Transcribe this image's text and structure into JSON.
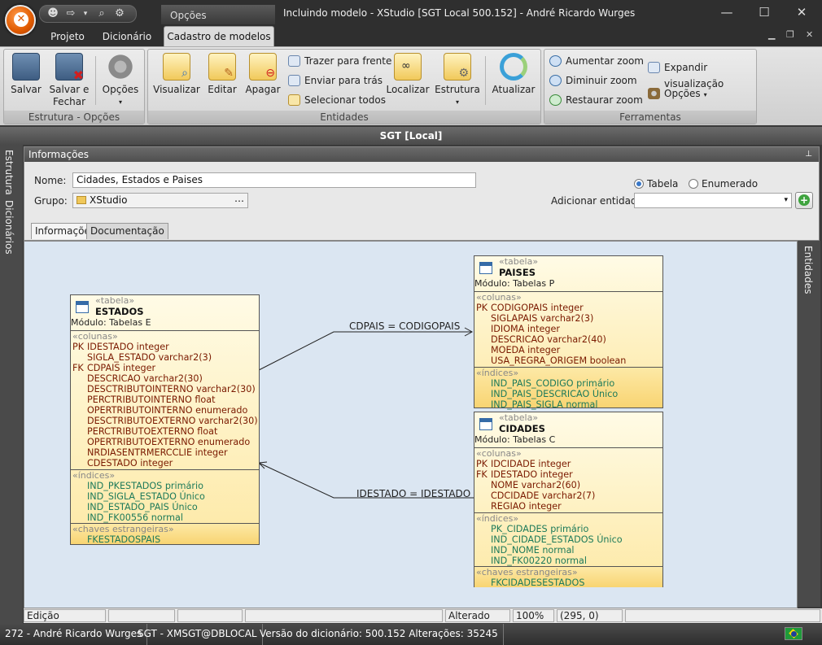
{
  "window": {
    "title": "Incluindo modelo - XStudio [SGT Local 500.152] - André Ricardo Wurges",
    "contextual_tab_group": "Opções"
  },
  "ribbon_tabs": [
    "Projeto",
    "Dicionário",
    "Cadastro de modelos"
  ],
  "ribbon": {
    "groups": {
      "estrutura_opcoes": {
        "caption": "Estrutura - Opções",
        "salvar": "Salvar",
        "salvar_fechar_1": "Salvar e",
        "salvar_fechar_2": "Fechar",
        "opcoes": "Opções"
      },
      "entidades": {
        "caption": "Entidades",
        "visualizar": "Visualizar",
        "editar": "Editar",
        "apagar": "Apagar",
        "trazer": "Trazer para frente",
        "enviar": "Enviar para trás",
        "selecionar": "Selecionar todos",
        "localizar": "Localizar",
        "estrutura": "Estrutura",
        "atualizar": "Atualizar"
      },
      "ferramentas": {
        "caption": "Ferramentas",
        "aumentar": "Aumentar zoom",
        "diminuir": "Diminuir zoom",
        "restaurar": "Restaurar zoom",
        "expandir": "Expandir visualização",
        "opcoes": "Opções"
      }
    }
  },
  "connection_bar": "SGT [Local]",
  "left_tabs": [
    "Estrutura",
    "Dicionários"
  ],
  "right_tabs": [
    "Entidades"
  ],
  "info_panel": {
    "header": "Informações",
    "nome_label": "Nome:",
    "nome_value": "Cidades, Estados e Paises",
    "grupo_label": "Grupo:",
    "grupo_value": "XStudio",
    "radio_tabela": "Tabela",
    "radio_enumerado": "Enumerado",
    "adicionar_label": "Adicionar entidade:",
    "tabs": [
      "Informações",
      "Documentação"
    ]
  },
  "diagram": {
    "estados": {
      "stereotype": "«tabela»",
      "name": "ESTADOS",
      "module": "Módulo: Tabelas E",
      "colunas_label": "«colunas»",
      "columns": [
        {
          "key": "PK",
          "text": "IDESTADO integer"
        },
        {
          "key": "",
          "text": "SIGLA_ESTADO varchar2(3)"
        },
        {
          "key": "FK",
          "text": "CDPAIS integer"
        },
        {
          "key": "",
          "text": "DESCRICAO varchar2(30)"
        },
        {
          "key": "",
          "text": "DESCTRIBUTOINTERNO varchar2(30)"
        },
        {
          "key": "",
          "text": "PERCTRIBUTOINTERNO float"
        },
        {
          "key": "",
          "text": "OPERTRIBUTOINTERNO enumerado"
        },
        {
          "key": "",
          "text": "DESCTRIBUTOEXTERNO varchar2(30)"
        },
        {
          "key": "",
          "text": "PERCTRIBUTOEXTERNO float"
        },
        {
          "key": "",
          "text": "OPERTRIBUTOEXTERNO enumerado"
        },
        {
          "key": "",
          "text": "NRDIASENTRMERCCLIE integer"
        },
        {
          "key": "",
          "text": "CDESTADO integer"
        }
      ],
      "indices_label": "«índices»",
      "indices": [
        "IND_PKESTADOS primário",
        "IND_SIGLA_ESTADO Único",
        "IND_ESTADO_PAIS Único",
        "IND_FK00556 normal"
      ],
      "fk_label": "«chaves estrangeiras»",
      "fks": [
        "FKESTADOSPAIS"
      ]
    },
    "paises": {
      "stereotype": "«tabela»",
      "name": "PAISES",
      "module": "Módulo: Tabelas P",
      "colunas_label": "«colunas»",
      "columns": [
        {
          "key": "PK",
          "text": "CODIGOPAIS integer"
        },
        {
          "key": "",
          "text": "SIGLAPAIS varchar2(3)"
        },
        {
          "key": "",
          "text": "IDIOMA integer"
        },
        {
          "key": "",
          "text": "DESCRICAO varchar2(40)"
        },
        {
          "key": "",
          "text": "MOEDA integer"
        },
        {
          "key": "",
          "text": "USA_REGRA_ORIGEM boolean"
        }
      ],
      "indices_label": "«índices»",
      "indices": [
        "IND_PAIS_CODIGO primário",
        "IND_PAIS_DESCRICAO Único",
        "IND_PAIS_SIGLA normal"
      ]
    },
    "cidades": {
      "stereotype": "«tabela»",
      "name": "CIDADES",
      "module": "Módulo: Tabelas C",
      "colunas_label": "«colunas»",
      "columns": [
        {
          "key": "PK",
          "text": "IDCIDADE integer"
        },
        {
          "key": "FK",
          "text": "IDESTADO integer"
        },
        {
          "key": "",
          "text": "NOME varchar2(60)"
        },
        {
          "key": "",
          "text": "CDCIDADE varchar2(7)"
        },
        {
          "key": "",
          "text": "REGIAO integer"
        }
      ],
      "indices_label": "«índices»",
      "indices": [
        "PK_CIDADES primário",
        "IND_CIDADE_ESTADOS Único",
        "IND_NOME normal",
        "IND_FK00220 normal"
      ],
      "fk_label": "«chaves estrangeiras»",
      "fks": [
        "FKCIDADESESTADOS"
      ]
    },
    "rel1_label": "CDPAIS = CODIGOPAIS",
    "rel2_label": "IDESTADO = IDESTADO"
  },
  "status": {
    "mode": "Edição",
    "state": "Alterado",
    "zoom": "100%",
    "coords": "(295, 0)"
  },
  "footer": {
    "user": "272 - André Ricardo Wurges",
    "db": "SGT - XMSGT@DBLOCAL",
    "version": "Versão do dicionário: 500.152 Alterações: 35245"
  },
  "colors": {
    "accent_orange": "#e05a00",
    "canvas_bg": "#dbe6f2",
    "entity_fill": "#fde9a6",
    "column_text": "#7a1a00",
    "index_text": "#1d7a5a"
  }
}
